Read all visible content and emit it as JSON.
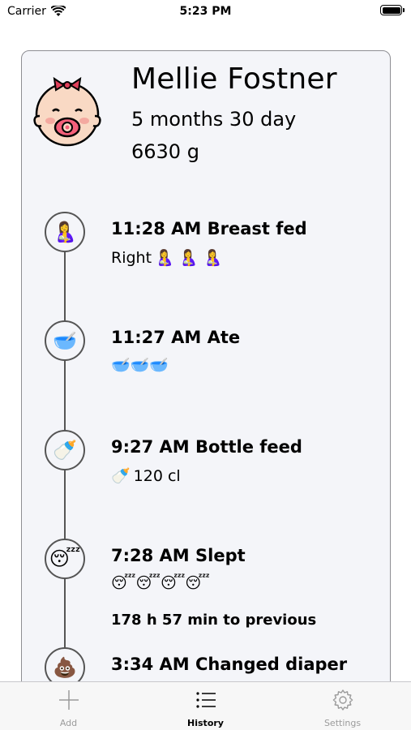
{
  "status_bar": {
    "carrier": "Carrier",
    "time": "5:23 PM"
  },
  "profile": {
    "name": "Mellie Fostner",
    "age": "5 months 30 day",
    "weight": "6630 g"
  },
  "events": [
    {
      "icon": "🤱",
      "icon_name": "breastfeeding-icon",
      "title": "11:28 AM Breast fed",
      "detail_text": "Right",
      "detail_emoji": "🤱 🤱 🤱"
    },
    {
      "icon": "🥣",
      "icon_name": "bowl-icon",
      "title": "11:27 AM Ate",
      "detail_text": "",
      "detail_emoji": "🥣🥣🥣"
    },
    {
      "icon": "🍼",
      "icon_name": "baby-bottle-icon",
      "title": "9:27 AM Bottle feed",
      "detail_text": "120 cl",
      "detail_emoji": "🍼"
    },
    {
      "icon": "😴",
      "icon_name": "sleeping-face-icon",
      "title": "7:28 AM Slept",
      "detail_text": "",
      "detail_emoji": "😴😴😴😴",
      "extra": "178 h 57 min to previous"
    },
    {
      "icon": "💩",
      "icon_name": "diaper-icon",
      "title": "3:34 AM Changed diaper",
      "detail_text": "",
      "detail_emoji": ""
    }
  ],
  "tabs": [
    {
      "label": "Add",
      "icon": "plus-icon",
      "active": false
    },
    {
      "label": "History",
      "icon": "list-icon",
      "active": true
    },
    {
      "label": "Settings",
      "icon": "gear-icon",
      "active": false
    }
  ],
  "colors": {
    "card_background": "#f4f5f9",
    "active_tab": "#000000",
    "inactive_tab": "#9b9b9b"
  }
}
